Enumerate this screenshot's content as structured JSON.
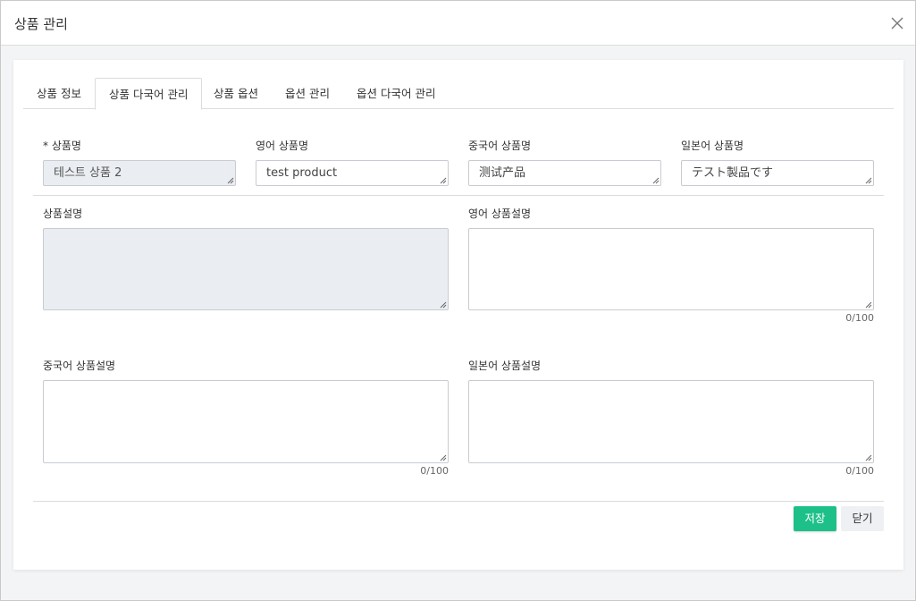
{
  "modal": {
    "title": "상품 관리"
  },
  "tabs": [
    {
      "label": "상품 정보"
    },
    {
      "label": "상품 다국어 관리"
    },
    {
      "label": "상품 옵션"
    },
    {
      "label": "옵션 관리"
    },
    {
      "label": "옵션 다국어 관리"
    }
  ],
  "active_tab": "상품 다국어 관리",
  "fields": {
    "name": {
      "label": "* 상품명",
      "value": "테스트 상품 2",
      "disabled": true
    },
    "name_en": {
      "label": "영어 상품명",
      "value": "test product"
    },
    "name_zh": {
      "label": "중국어 상품명",
      "value": "测试产品"
    },
    "name_ja": {
      "label": "일본어 상품명",
      "value": "テスト製品です"
    },
    "desc": {
      "label": "상품설명",
      "value": "",
      "disabled": true
    },
    "desc_en": {
      "label": "영어 상품설명",
      "value": "",
      "counter": "0/100"
    },
    "desc_zh": {
      "label": "중국어 상품설명",
      "value": "",
      "counter": "0/100"
    },
    "desc_ja": {
      "label": "일본어 상품설명",
      "value": "",
      "counter": "0/100"
    }
  },
  "buttons": {
    "save": "저장",
    "close": "닫기"
  },
  "colors": {
    "primary": "#1ec089",
    "disabled_bg": "#eaedf1"
  }
}
